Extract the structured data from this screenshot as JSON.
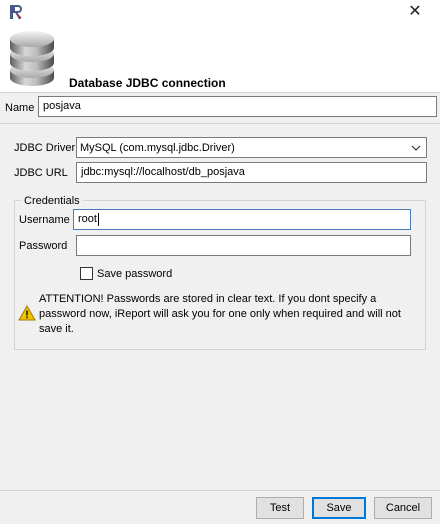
{
  "dialog": {
    "title": "Database JDBC connection",
    "close_glyph": "✕"
  },
  "name": {
    "label": "Name",
    "value": "posjava"
  },
  "jdbc_driver": {
    "label": "JDBC Driver",
    "selected": "MySQL (com.mysql.jdbc.Driver)"
  },
  "jdbc_url": {
    "label": "JDBC URL",
    "value": "jdbc:mysql://localhost/db_posjava"
  },
  "credentials": {
    "legend": "Credentials",
    "username_label": "Username",
    "username_value": "root",
    "password_label": "Password",
    "password_value": "",
    "save_password_label": "Save password",
    "save_password_checked": false
  },
  "warning": {
    "text": "ATTENTION! Passwords are stored in clear text. If you dont specify a password now, iReport will ask you for one only when required and will not save it."
  },
  "buttons": {
    "test": "Test",
    "save": "Save",
    "cancel": "Cancel"
  },
  "colors": {
    "default_button_border": "#0078d7",
    "warning_icon": "#f2c200"
  }
}
